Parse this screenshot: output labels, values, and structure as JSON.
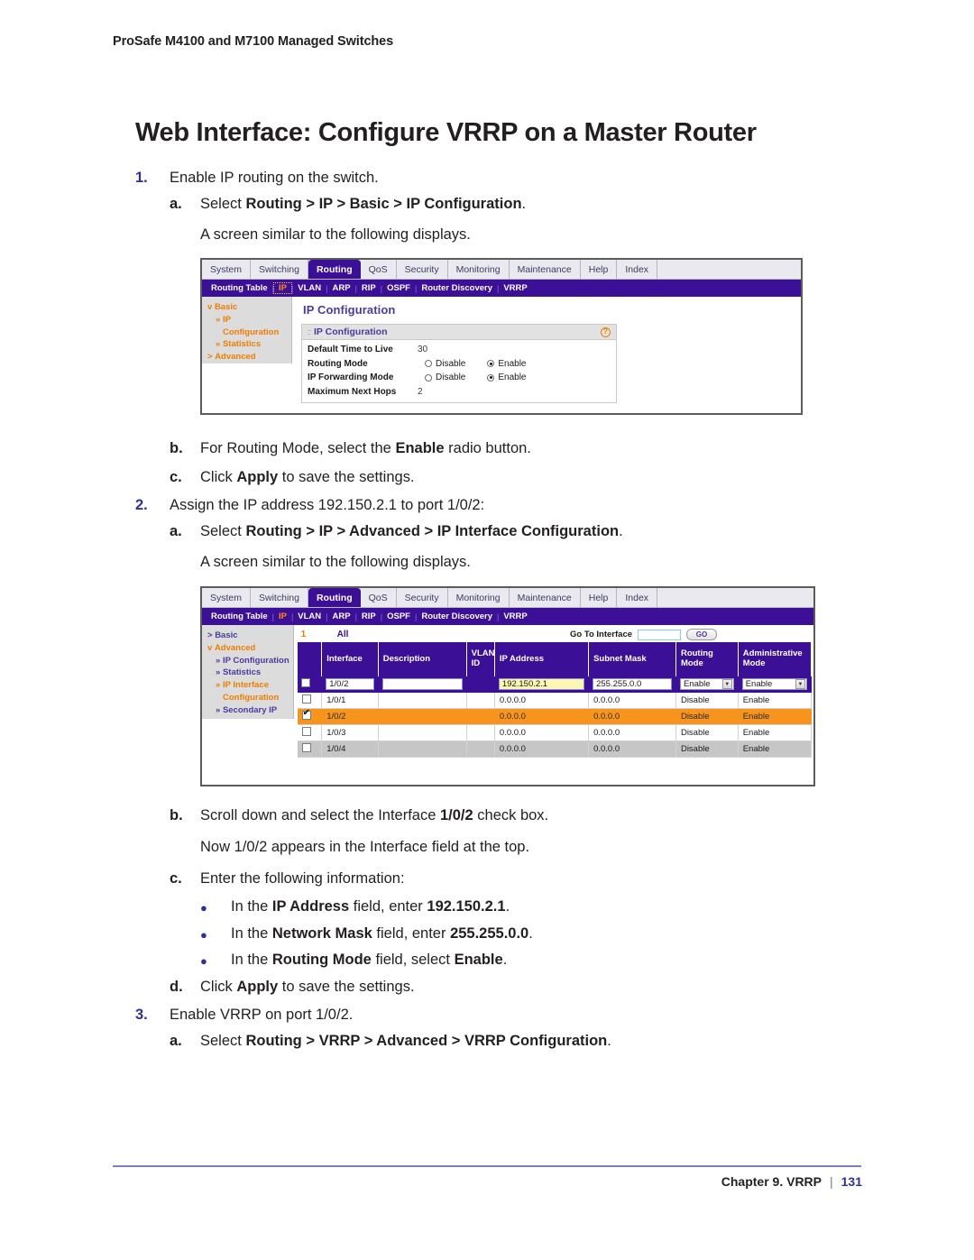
{
  "document": {
    "running_head": "ProSafe M4100 and M7100 Managed Switches",
    "page_title": "Web Interface: Configure VRRP on a Master Router",
    "footer": {
      "chapter": "Chapter 9.  VRRP",
      "separator": "|",
      "page_number": "131"
    }
  },
  "steps": {
    "s1_marker": "1.",
    "s1_text": "Enable IP routing on the switch.",
    "s1a_marker": "a.",
    "s1a_pre": "Select ",
    "s1a_bold": "Routing > IP > Basic > IP Configuration",
    "s1a_post": ".",
    "s1a_note": "A screen similar to the following displays.",
    "s1b_marker": "b.",
    "s1b_pre": "For Routing Mode, select the ",
    "s1b_bold": "Enable",
    "s1b_post": " radio button.",
    "s1c_marker": "c.",
    "s1c_pre": "Click ",
    "s1c_bold": "Apply",
    "s1c_post": " to save the settings.",
    "s2_marker": "2.",
    "s2_text": "Assign the IP address 192.150.2.1 to port 1/0/2:",
    "s2a_marker": "a.",
    "s2a_pre": "Select ",
    "s2a_bold": "Routing > IP > Advanced > IP Interface Configuration",
    "s2a_post": ".",
    "s2a_note": "A screen similar to the following displays.",
    "s2b_marker": "b.",
    "s2b_pre": "Scroll down and select the Interface ",
    "s2b_bold": "1/0/2",
    "s2b_post": " check box.",
    "s2b_note": "Now 1/0/2 appears in the Interface field at the top.",
    "s2c_marker": "c.",
    "s2c_text": "Enter the following information:",
    "s2c_b1_pre": "In the ",
    "s2c_b1_bold1": "IP Address",
    "s2c_b1_mid": " field, enter ",
    "s2c_b1_bold2": "192.150.2.1",
    "s2c_b1_post": ".",
    "s2c_b2_pre": "In the ",
    "s2c_b2_bold1": "Network Mask",
    "s2c_b2_mid": " field, enter ",
    "s2c_b2_bold2": "255.255.0.0",
    "s2c_b2_post": ".",
    "s2c_b3_pre": "In the ",
    "s2c_b3_bold1": "Routing Mode",
    "s2c_b3_mid": " field, select ",
    "s2c_b3_bold2": "Enable",
    "s2c_b3_post": ".",
    "s2d_marker": "d.",
    "s2d_pre": "Click ",
    "s2d_bold": "Apply",
    "s2d_post": " to save the settings.",
    "s3_marker": "3.",
    "s3_text": "Enable VRRP on port 1/0/2.",
    "s3a_marker": "a.",
    "s3a_pre": "Select ",
    "s3a_bold": "Routing > VRRP > Advanced > VRRP Configuration",
    "s3a_post": "."
  },
  "screenshot1": {
    "tabs": [
      "System",
      "Switching",
      "Routing",
      "QoS",
      "Security",
      "Monitoring",
      "Maintenance",
      "Help",
      "Index"
    ],
    "active_tab": "Routing",
    "subnav": [
      "Routing Table",
      "IP",
      "VLAN",
      "ARP",
      "RIP",
      "OSPF",
      "Router Discovery",
      "VRRP"
    ],
    "subnav_selected": "IP",
    "sidebar": [
      {
        "label": "Basic",
        "level": 1,
        "color": "orange",
        "marker": "v"
      },
      {
        "label": "IP",
        "level": 2,
        "color": "orange",
        "marker": "»"
      },
      {
        "label": "Configuration",
        "level": 3,
        "color": "orange",
        "marker": ""
      },
      {
        "label": "Statistics",
        "level": 2,
        "color": "orange",
        "marker": "»"
      },
      {
        "label": "Advanced",
        "level": 1,
        "color": "orange",
        "marker": ">"
      }
    ],
    "content_heading": "IP Configuration",
    "panel_title": "IP Configuration",
    "help_glyph": "?",
    "fields": [
      {
        "label": "Default Time to Live",
        "type": "text",
        "value": "30"
      },
      {
        "label": "Routing Mode",
        "type": "radio",
        "options": [
          "Disable",
          "Enable"
        ],
        "selected": "Enable"
      },
      {
        "label": "IP Forwarding Mode",
        "type": "radio",
        "options": [
          "Disable",
          "Enable"
        ],
        "selected": "Enable"
      },
      {
        "label": "Maximum Next Hops",
        "type": "text",
        "value": "2"
      }
    ]
  },
  "screenshot2": {
    "tabs": [
      "System",
      "Switching",
      "Routing",
      "QoS",
      "Security",
      "Monitoring",
      "Maintenance",
      "Help",
      "Index"
    ],
    "active_tab": "Routing",
    "subnav": [
      "Routing Table",
      "IP",
      "VLAN",
      "ARP",
      "RIP",
      "OSPF",
      "Router Discovery",
      "VRRP"
    ],
    "subnav_selected": "IP",
    "sidebar": [
      {
        "label": "Basic",
        "level": 1,
        "color": "purple",
        "marker": ">"
      },
      {
        "label": "Advanced",
        "level": 1,
        "color": "orange",
        "marker": "v"
      },
      {
        "label": "IP Configuration",
        "level": 2,
        "color": "purple",
        "marker": "»"
      },
      {
        "label": "Statistics",
        "level": 2,
        "color": "purple",
        "marker": "»"
      },
      {
        "label": "IP Interface",
        "level": 2,
        "color": "orange",
        "marker": "»"
      },
      {
        "label": "Configuration",
        "level": 3,
        "color": "orange",
        "marker": ""
      },
      {
        "label": "Secondary IP",
        "level": 2,
        "color": "purple",
        "marker": "»"
      }
    ],
    "page_indicator": "1",
    "all_label": "All",
    "goto_label": "Go To Interface",
    "goto_value": "",
    "go_button": "GO",
    "columns": [
      "",
      "Interface",
      "Description",
      "VLAN ID",
      "IP Address",
      "Subnet Mask",
      "Routing Mode",
      "Administrative Mode"
    ],
    "edit_row": {
      "checkbox": false,
      "interface": "1/0/2",
      "description": "",
      "vlan_id": "",
      "ip_address": "192.150.2.1",
      "subnet_mask": "255.255.0.0",
      "routing_mode": "Enable",
      "administrative_mode": "Enable"
    },
    "rows": [
      {
        "checked": false,
        "interface": "1/0/1",
        "description": "",
        "vlan_id": "",
        "ip_address": "0.0.0.0",
        "subnet_mask": "0.0.0.0",
        "routing_mode": "Disable",
        "administrative_mode": "Enable",
        "style": "normal"
      },
      {
        "checked": true,
        "interface": "1/0/2",
        "description": "",
        "vlan_id": "",
        "ip_address": "0.0.0.0",
        "subnet_mask": "0.0.0.0",
        "routing_mode": "Disable",
        "administrative_mode": "Enable",
        "style": "selected"
      },
      {
        "checked": false,
        "interface": "1/0/3",
        "description": "",
        "vlan_id": "",
        "ip_address": "0.0.0.0",
        "subnet_mask": "0.0.0.0",
        "routing_mode": "Disable",
        "administrative_mode": "Enable",
        "style": "normal"
      },
      {
        "checked": false,
        "interface": "1/0/4",
        "description": "",
        "vlan_id": "",
        "ip_address": "0.0.0.0",
        "subnet_mask": "0.0.0.0",
        "routing_mode": "Disable",
        "administrative_mode": "Enable",
        "style": "alt"
      }
    ]
  },
  "colors": {
    "nav_purple": "#3b0f96",
    "accent_orange": "#f07d00",
    "highlight_orange": "#f7941d",
    "link_purple": "#4c3a9e",
    "step_number_blue": "#2e3192",
    "field_yellow": "#fbf6b2"
  }
}
